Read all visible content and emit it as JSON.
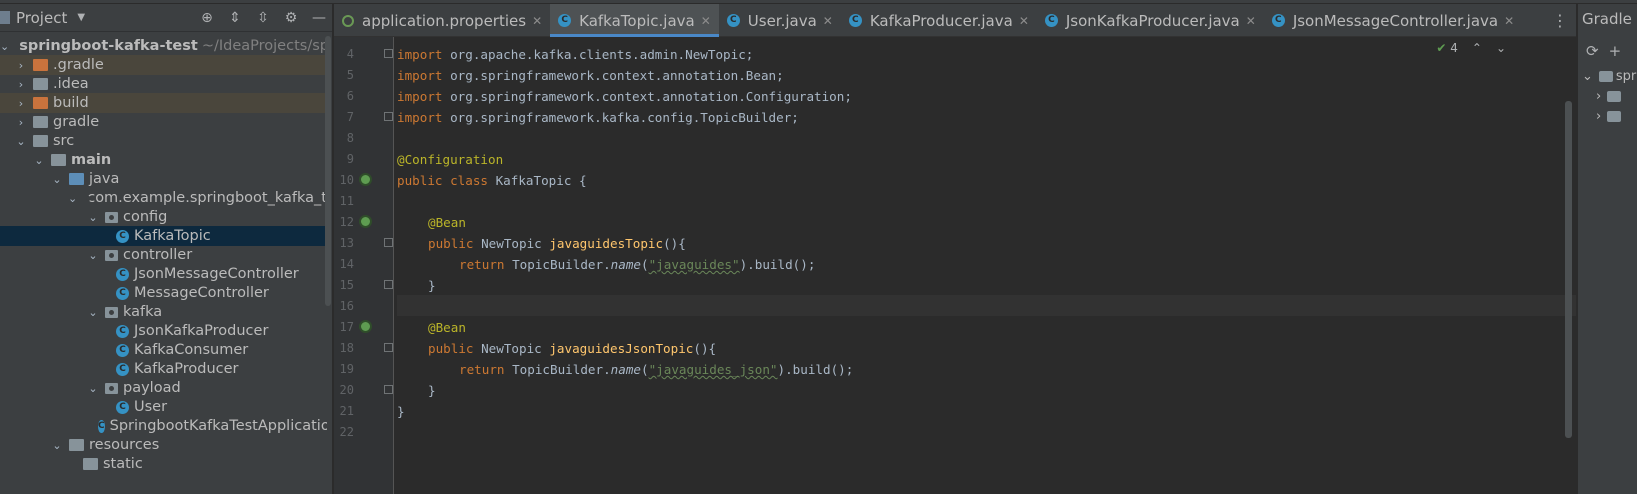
{
  "project_panel": {
    "title": "Project",
    "tree": [
      {
        "label": "springboot-kafka-test",
        "path": "~/IdeaProjects/sprin"
      },
      {
        "label": ".gradle"
      },
      {
        "label": ".idea"
      },
      {
        "label": "build"
      },
      {
        "label": "gradle"
      },
      {
        "label": "src"
      },
      {
        "label": "main"
      },
      {
        "label": "java"
      },
      {
        "label": "com.example.springboot_kafka_te"
      },
      {
        "label": "config"
      },
      {
        "label": "KafkaTopic"
      },
      {
        "label": "controller"
      },
      {
        "label": "JsonMessageController"
      },
      {
        "label": "MessageController"
      },
      {
        "label": "kafka"
      },
      {
        "label": "JsonKafkaProducer"
      },
      {
        "label": "KafkaConsumer"
      },
      {
        "label": "KafkaProducer"
      },
      {
        "label": "payload"
      },
      {
        "label": "User"
      },
      {
        "label": "SpringbootKafkaTestApplicatio"
      },
      {
        "label": "resources"
      },
      {
        "label": "static"
      }
    ]
  },
  "tabs": [
    {
      "label": "application.properties"
    },
    {
      "label": "KafkaTopic.java"
    },
    {
      "label": "User.java"
    },
    {
      "label": "KafkaProducer.java"
    },
    {
      "label": "JsonKafkaProducer.java"
    },
    {
      "label": "JsonMessageController.java"
    }
  ],
  "editor": {
    "inspection_count": "4",
    "line_numbers": [
      "4",
      "5",
      "6",
      "7",
      "8",
      "9",
      "10",
      "11",
      "12",
      "13",
      "14",
      "15",
      "16",
      "17",
      "18",
      "19",
      "20",
      "21",
      "22"
    ],
    "code": {
      "l4": {
        "kw": "import",
        "rest": " org.apache.kafka.clients.admin.NewTopic;"
      },
      "l5": {
        "kw": "import",
        "rest": " org.springframework.context.annotation.Bean;"
      },
      "l6": {
        "kw": "import",
        "rest": " org.springframework.context.annotation.Configuration;"
      },
      "l7": {
        "kw": "import",
        "rest": " org.springframework.kafka.config.TopicBuilder;"
      },
      "l9": {
        "ann": "@Configuration"
      },
      "l10": {
        "kw": "public class",
        "rest": " KafkaTopic {"
      },
      "l12": {
        "ann": "@Bean"
      },
      "l13": {
        "kw": "public",
        "type": " NewTopic ",
        "fn": "javaguidesTopic",
        "rest": "(){"
      },
      "l14": {
        "kw": "return",
        "pre": " TopicBuilder.",
        "method": "name",
        "open": "(",
        "str": "\"javaguides\"",
        "rest": ").build();"
      },
      "l15": {
        "rest": "}"
      },
      "l17": {
        "ann": "@Bean"
      },
      "l18": {
        "kw": "public",
        "type": " NewTopic ",
        "fn": "javaguidesJsonTopic",
        "rest": "(){"
      },
      "l19": {
        "kw": "return",
        "pre": " TopicBuilder.",
        "method": "name",
        "open": "(",
        "str": "\"javaguides_json\"",
        "rest": ").build();"
      },
      "l20": {
        "rest": "}"
      },
      "l21": {
        "rest": "}"
      }
    }
  },
  "gradle_panel": {
    "title": "Gradle",
    "root_label": "spr"
  },
  "colors": {
    "accent": "#4a88c7",
    "keyword": "#cc7832",
    "annotation": "#bbb529",
    "string": "#6a8759",
    "method": "#ffc66d"
  }
}
